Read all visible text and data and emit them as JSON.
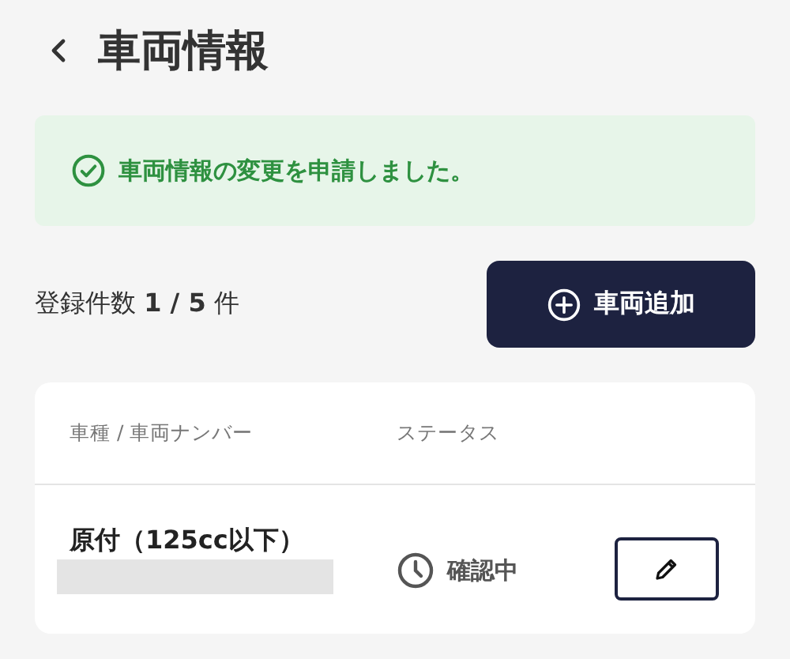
{
  "header": {
    "back_icon": true,
    "title": "車両情報"
  },
  "alert": {
    "kind": "success",
    "message": "車両情報の変更を申請しました。"
  },
  "summary": {
    "count_text": "登録件数 **1 / 5** 件",
    "add_button": "車両追加"
  },
  "table": {
    "columns": [
      "車種 / 車両ナンバー",
      "ステータス"
    ],
    "rows": [
      {
        "vehicle_type": "原付（125cc以下）",
        "plate_redacted": true,
        "status": {
          "kind": "pending",
          "label": "確認中"
        },
        "edit_button": true
      }
    ]
  }
}
